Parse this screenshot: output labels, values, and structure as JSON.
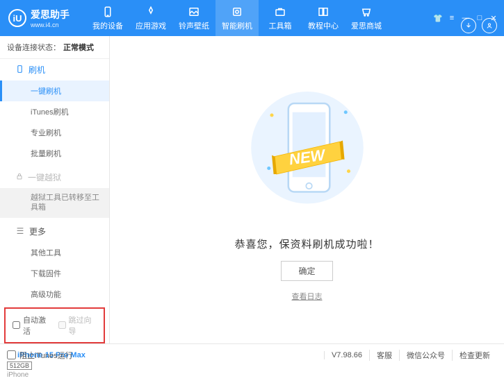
{
  "app": {
    "name": "爱思助手",
    "url": "www.i4.cn",
    "logo_letter": "iU"
  },
  "nav": {
    "items": [
      {
        "label": "我的设备"
      },
      {
        "label": "应用游戏"
      },
      {
        "label": "铃声壁纸"
      },
      {
        "label": "智能刷机"
      },
      {
        "label": "工具箱"
      },
      {
        "label": "教程中心"
      },
      {
        "label": "爱思商城"
      }
    ],
    "active_index": 3
  },
  "sidebar": {
    "status_label": "设备连接状态：",
    "status_value": "正常模式",
    "group_flash": "刷机",
    "subs_flash": [
      "一键刷机",
      "iTunes刷机",
      "专业刷机",
      "批量刷机"
    ],
    "group_jailbreak": "一键越狱",
    "jailbreak_note": "越狱工具已转移至工具箱",
    "group_more": "更多",
    "subs_more": [
      "其他工具",
      "下载固件",
      "高级功能"
    ],
    "checkbox1": "自动激活",
    "checkbox2": "跳过向导",
    "device": {
      "name": "iPhone 15 Pro Max",
      "storage": "512GB",
      "type": "iPhone"
    }
  },
  "main": {
    "success": "恭喜您，保资料刷机成功啦！",
    "ok": "确定",
    "log": "查看日志",
    "new_badge": "NEW"
  },
  "footer": {
    "block_itunes": "阻止iTunes运行",
    "version": "V7.98.66",
    "support": "客服",
    "wechat": "微信公众号",
    "update": "检查更新"
  }
}
